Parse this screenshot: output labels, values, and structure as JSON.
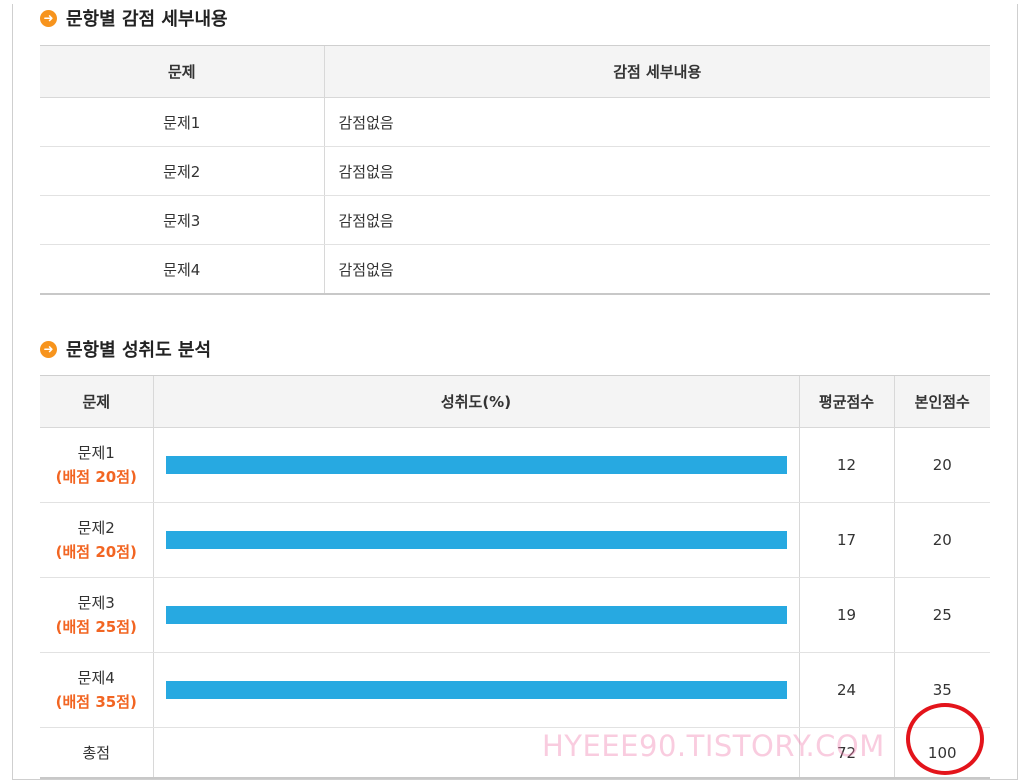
{
  "deduction_section": {
    "title": "문항별 감점 세부내용",
    "headers": [
      "문제",
      "감점 세부내용"
    ],
    "rows": [
      {
        "question": "문제1",
        "detail": "감점없음"
      },
      {
        "question": "문제2",
        "detail": "감점없음"
      },
      {
        "question": "문제3",
        "detail": "감점없음"
      },
      {
        "question": "문제4",
        "detail": "감점없음"
      }
    ]
  },
  "analysis_section": {
    "title": "문항별 성취도 분석",
    "headers": [
      "문제",
      "성취도(%)",
      "평균점수",
      "본인점수"
    ],
    "rows": [
      {
        "question": "문제1",
        "points": "(배점 20점)",
        "achievement": 100,
        "average": "12",
        "score": "20"
      },
      {
        "question": "문제2",
        "points": "(배점 20점)",
        "achievement": 100,
        "average": "17",
        "score": "20"
      },
      {
        "question": "문제3",
        "points": "(배점 25점)",
        "achievement": 100,
        "average": "19",
        "score": "25"
      },
      {
        "question": "문제4",
        "points": "(배점 35점)",
        "achievement": 100,
        "average": "24",
        "score": "35"
      }
    ],
    "total": {
      "label": "총점",
      "average": "72",
      "score": "100"
    }
  },
  "watermark": "HYEEE90.TISTORY.COM",
  "colors": {
    "accent": "#f7941d",
    "bar": "#27a9e1",
    "points_text": "#f26522",
    "highlight_circle": "#e3141b"
  }
}
